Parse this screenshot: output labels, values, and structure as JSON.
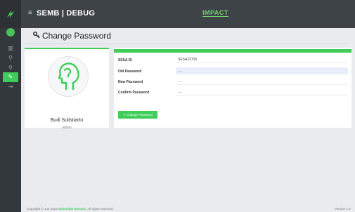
{
  "header": {
    "menu_icon": "hamburger-icon",
    "app_title": "SEMB | DEBUG",
    "brand": "IMPACT"
  },
  "sidebar": {
    "items": [
      {
        "icon": "chart-icon"
      },
      {
        "icon": "search-icon"
      },
      {
        "icon": "search-icon"
      },
      {
        "icon": "wrench-icon",
        "active": true
      },
      {
        "icon": "sign-out-icon"
      }
    ]
  },
  "page": {
    "title": "Change Password"
  },
  "profile": {
    "name": "Budi Sulistiarto",
    "role": "admin"
  },
  "form": {
    "sesa_label": "SESA ID",
    "sesa_value": "SESA23700",
    "old_label": "Old Password",
    "old_value": "....",
    "new_label": "New Password",
    "new_value": "....",
    "confirm_label": "Confirm Password",
    "confirm_value": "....",
    "button_label": "Change Password"
  },
  "footer": {
    "copyright_prefix": "Copyright © Jun 2023",
    "company": "Schneider Electric.",
    "copyright_suffix": "All rights reserved.",
    "version": "Version 1.0"
  },
  "colors": {
    "accent": "#3dcd58",
    "topbar": "#3e4347",
    "sidebar": "#33383c"
  }
}
